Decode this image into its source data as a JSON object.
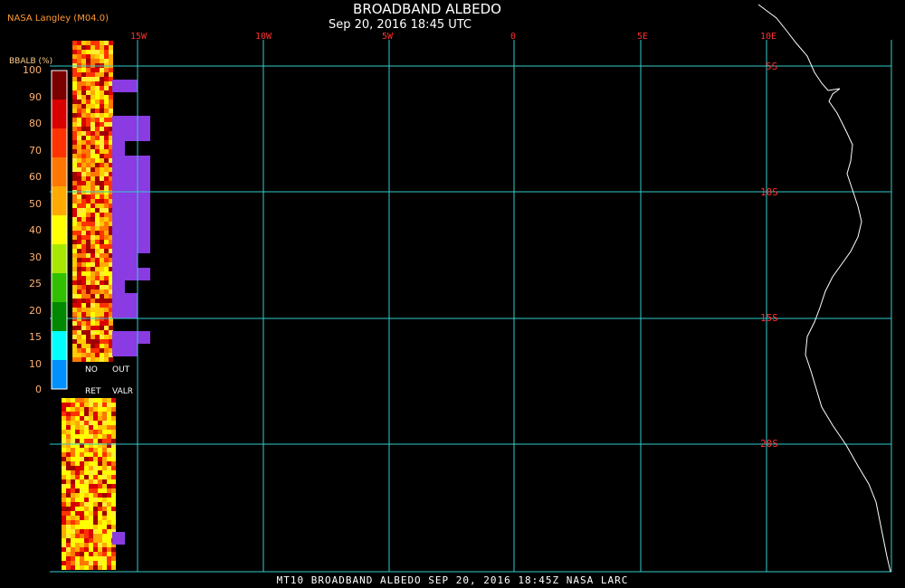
{
  "title": "BROADBAND ALBEDO",
  "subtitle": "Sep 20, 2016 18:45 UTC",
  "source": "NASA Langley (M04.0)",
  "footer": "MT10  BROADBAND ALBEDO  SEP 20, 2016 18:45Z  NASA LARC",
  "lon_labels": [
    "15W",
    "10W",
    "5W",
    "0",
    "5E",
    "10E"
  ],
  "lat_labels": [
    "5S",
    "10S",
    "15S",
    "20S"
  ],
  "colorbar": {
    "title": "BBALB (%)",
    "ticks": [
      "100",
      "90",
      "80",
      "70",
      "60",
      "50",
      "40",
      "30",
      "25",
      "20",
      "15",
      "10",
      "0"
    ],
    "colors": [
      "#7a0000",
      "#d80000",
      "#ff3300",
      "#ff7700",
      "#ffaa00",
      "#ffff00",
      "#a8e800",
      "#30c000",
      "#008800",
      "#00ffff",
      "#0090ff",
      "#0000ff",
      "#8a2be2"
    ],
    "no_ret_top": "NO",
    "no_ret_bottom": "RET",
    "out_valr_top": "OUT",
    "out_valr_bottom": "VALR"
  },
  "colors": {
    "grid": "#33cccc",
    "lat_label": "#ff3030",
    "coast": "#ffffff",
    "no_retrieval": "#8a3be2"
  }
}
